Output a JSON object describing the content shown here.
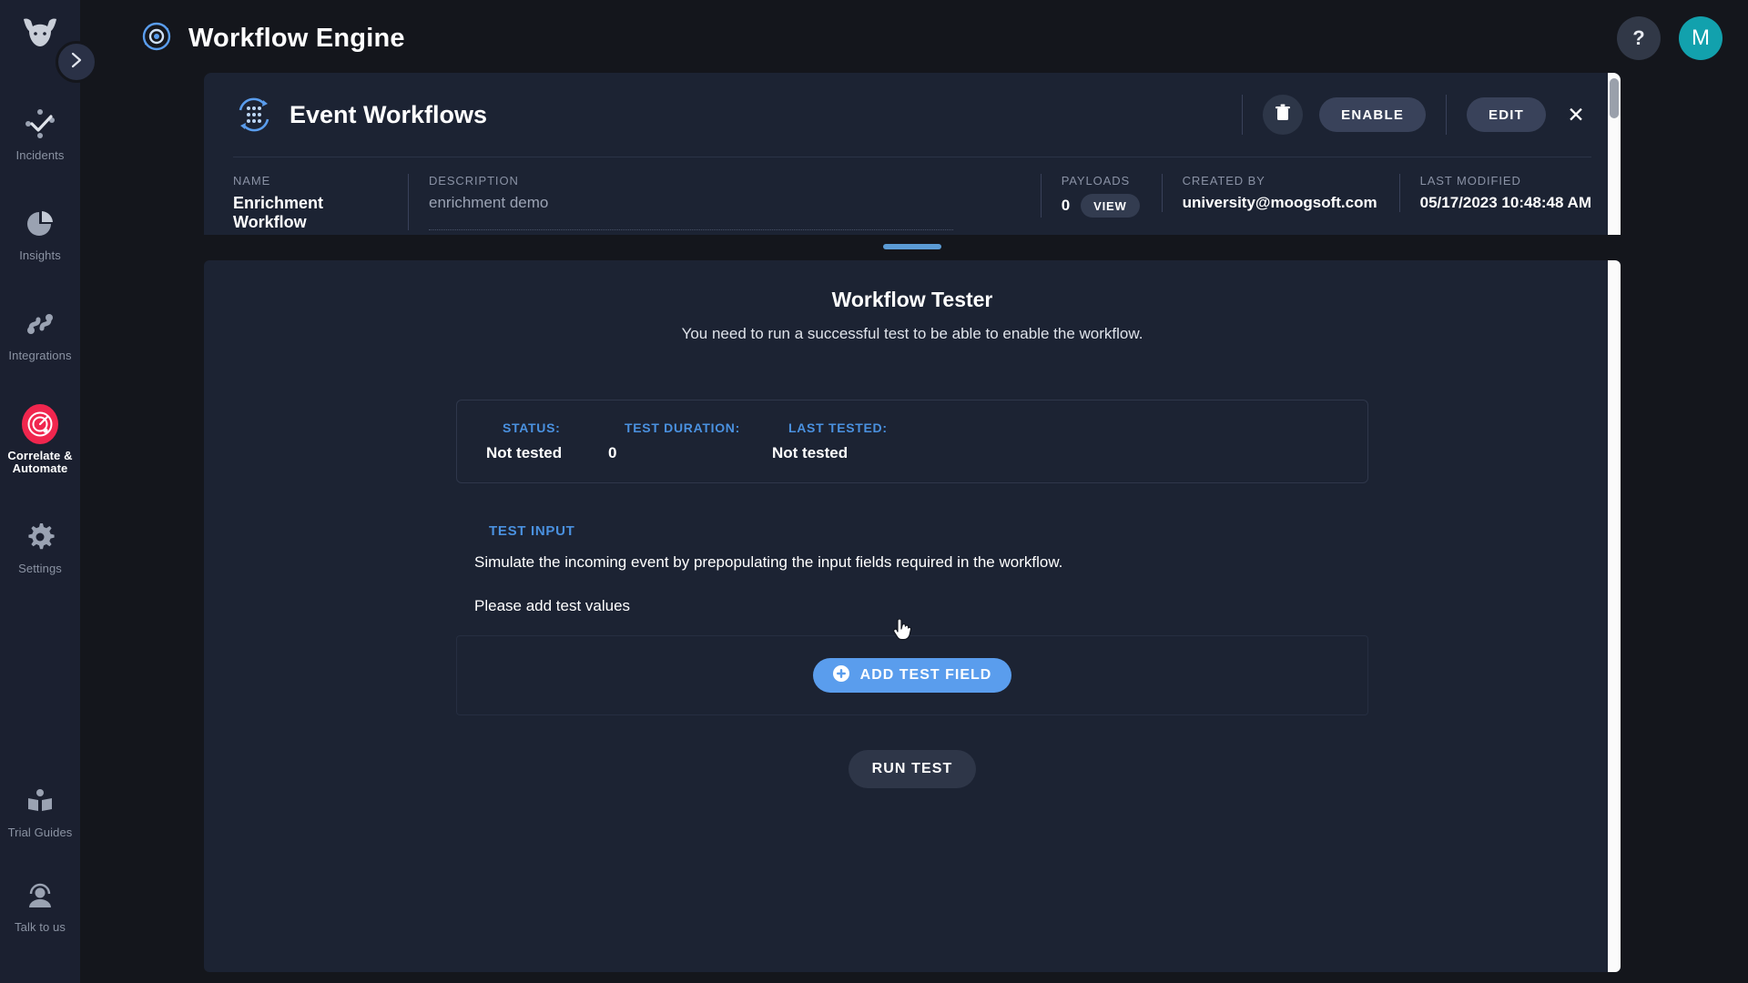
{
  "app": {
    "title": "Workflow Engine",
    "logo_icon": "bull-head-logo",
    "app_icon": "workflow-cycle-icon",
    "help_label": "?",
    "avatar_initial": "M",
    "accent_blue": "#5a9ded",
    "accent_red": "#f0264e",
    "avatar_teal": "#12a1ad",
    "label_blue": "#4a91e0"
  },
  "sidebar": {
    "toggle_icon": "chevron-right-icon",
    "items": [
      {
        "label": "Incidents",
        "icon": "incidents-nodes-icon",
        "active": false
      },
      {
        "label": "Insights",
        "icon": "pie-chart-icon",
        "active": false
      },
      {
        "label": "Integrations",
        "icon": "integrations-link-icon",
        "active": false
      },
      {
        "label": "Correlate & Automate",
        "icon": "target-radar-icon",
        "active": true
      },
      {
        "label": "Settings",
        "icon": "gear-icon",
        "active": false
      }
    ],
    "bottom_items": [
      {
        "label": "Trial Guides",
        "icon": "open-book-icon"
      },
      {
        "label": "Talk to us",
        "icon": "support-agent-icon"
      }
    ]
  },
  "panel": {
    "title": "Event Workflows",
    "icon": "event-workflows-dotgrid-icon",
    "actions": {
      "delete_icon": "trash-icon",
      "enable_label": "ENABLE",
      "edit_label": "EDIT",
      "close_icon": "close-icon"
    },
    "meta": {
      "name_label": "NAME",
      "name_value": "Enrichment Workflow",
      "description_label": "DESCRIPTION",
      "description_value": "enrichment demo",
      "payloads_label": "PAYLOADS",
      "payloads_value": "0",
      "payloads_view_label": "VIEW",
      "created_by_label": "CREATED BY",
      "created_by_value": "university@moogsoft.com",
      "last_modified_label": "LAST MODIFIED",
      "last_modified_value": "05/17/2023 10:48:48 AM"
    }
  },
  "tester": {
    "title": "Workflow Tester",
    "subtitle": "You need to run a successful test to be able to enable the workflow.",
    "status": {
      "status_label": "STATUS:",
      "status_value": "Not tested",
      "duration_label": "TEST DURATION:",
      "duration_value": "0",
      "last_tested_label": "LAST TESTED:",
      "last_tested_value": "Not tested"
    },
    "test_input": {
      "label": "TEST INPUT",
      "description": "Simulate the incoming event by prepopulating the input fields required in the workflow.",
      "note": "Please add test values",
      "add_field_label": "ADD TEST FIELD",
      "add_field_icon": "plus-circle-icon"
    },
    "run_test_label": "RUN TEST"
  }
}
